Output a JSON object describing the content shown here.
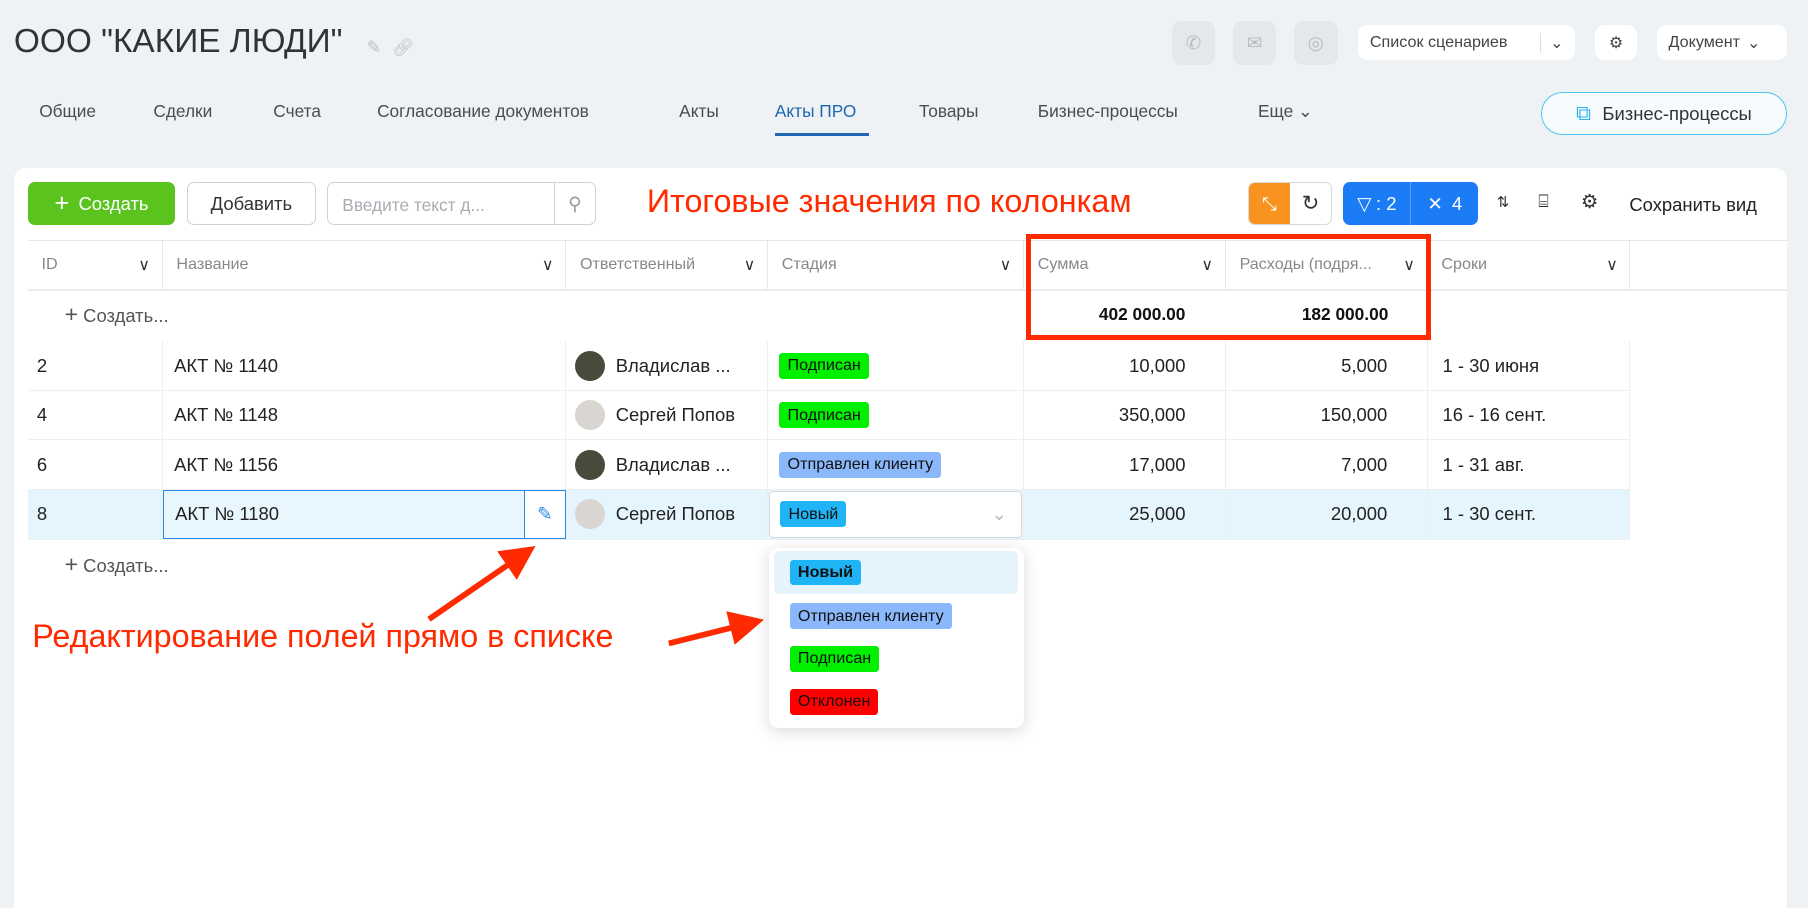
{
  "header": {
    "title": "ООО \"КАКИЕ ЛЮДИ\"",
    "scenarios_label": "Список сценариев",
    "document_label": "Документ"
  },
  "tabs": [
    {
      "label": "Общие"
    },
    {
      "label": "Сделки"
    },
    {
      "label": "Счета"
    },
    {
      "label": "Согласование документов"
    },
    {
      "label": "Акты"
    },
    {
      "label": "Акты ПРО"
    },
    {
      "label": "Товары"
    },
    {
      "label": "Бизнес-процессы"
    },
    {
      "label": "Еще"
    }
  ],
  "bp_button": "Бизнес-процессы",
  "toolbar": {
    "create": "Создать",
    "add": "Добавить",
    "search_placeholder": "Введите текст д...",
    "filter_count": ": 2",
    "close_count": "4",
    "save_view": "Сохранить вид"
  },
  "annotations": {
    "totals": "Итоговые значения по колонкам",
    "inline_edit": "Редактирование полей прямо в списке"
  },
  "columns": [
    "ID",
    "Название",
    "Ответственный",
    "Стадия",
    "Сумма",
    "Расходы (подря...",
    "Сроки"
  ],
  "create_row": "Создать...",
  "totals": {
    "sum": "402 000.00",
    "expenses": "182 000.00"
  },
  "rows": [
    {
      "id": "2",
      "name": "АКТ № 1140",
      "person": "Владислав ...",
      "stage": "Подписан",
      "sum": "10,000",
      "exp": "5,000",
      "term": "1 - 30 июня"
    },
    {
      "id": "4",
      "name": "АКТ № 1148",
      "person": "Сергей Попов",
      "stage": "Подписан",
      "sum": "350,000",
      "exp": "150,000",
      "term": "16 - 16 сент."
    },
    {
      "id": "6",
      "name": "АКТ № 1156",
      "person": "Владислав ...",
      "stage": "Отправлен клиенту",
      "sum": "17,000",
      "exp": "7,000",
      "term": "1 - 31 авг."
    },
    {
      "id": "8",
      "name": "АКТ № 1180",
      "person": "Сергей Попов",
      "stage": "Новый",
      "sum": "25,000",
      "exp": "20,000",
      "term": "1 - 30 сент."
    }
  ],
  "stage_options": [
    {
      "label": "Новый",
      "color": "#1eb4f5"
    },
    {
      "label": "Отправлен клиенту",
      "color": "#8ab8fb"
    },
    {
      "label": "Подписан",
      "color": "#00f000"
    },
    {
      "label": "Отклонен",
      "color": "#ff0000"
    }
  ],
  "colors": {
    "accent": "#2066b0",
    "green": "#5ac31e",
    "annotation": "#ff2a00",
    "orange": "#f7931e",
    "filter_blue": "#1b7cf5"
  }
}
